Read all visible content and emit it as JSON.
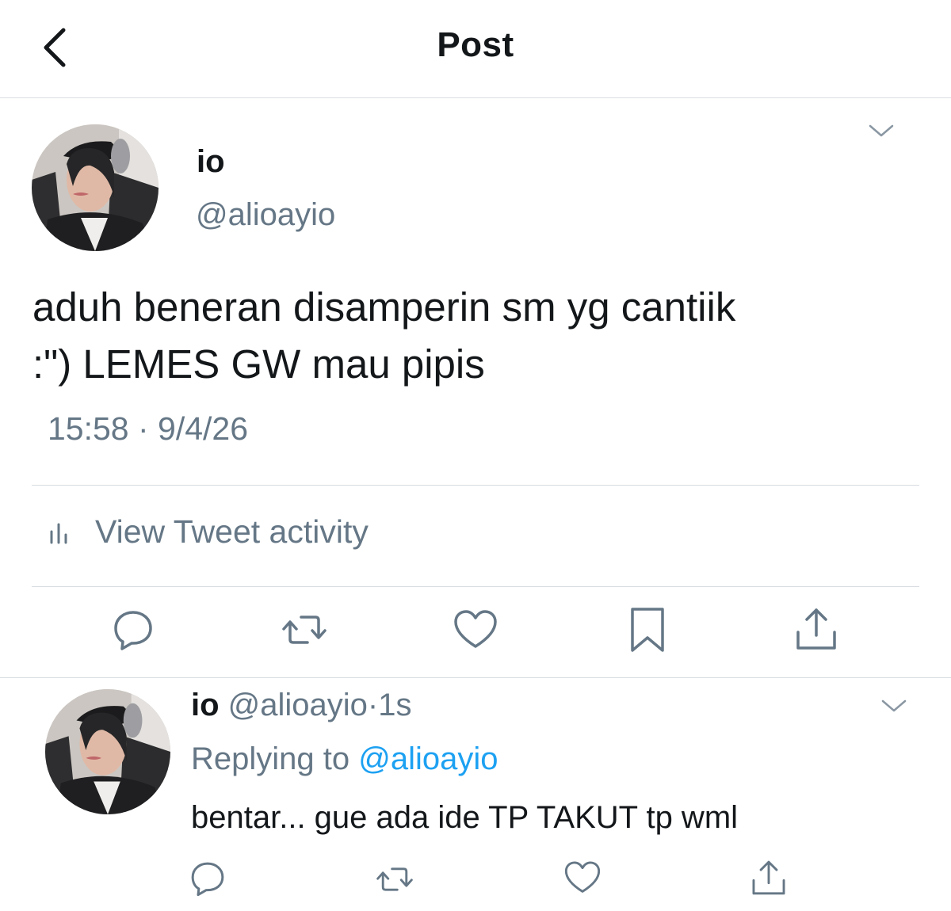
{
  "header": {
    "title": "Post",
    "back_icon": "chevron-left-icon"
  },
  "tweet": {
    "author_name": "io",
    "author_handle": "@alioayio",
    "text_line1": "aduh beneran disamperin sm yg cantiik",
    "text_line2": ":\") LEMES GW mau pipis",
    "timestamp": "15:58 · 9/4/26",
    "activity_label": "View Tweet activity",
    "actions": [
      "reply-icon",
      "retweet-icon",
      "like-icon",
      "bookmark-icon",
      "share-icon"
    ]
  },
  "reply": {
    "author_name": "io",
    "author_handle": "@alioayio",
    "time": "·1s",
    "replying_prefix": "Replying to",
    "replying_to": "@alioayio",
    "text": "bentar... gue ada ide TP TAKUT tp wml",
    "actions": [
      "reply-icon",
      "retweet-icon",
      "like-icon",
      "share-icon"
    ]
  },
  "colors": {
    "text_primary": "#14171a",
    "text_secondary": "#657786",
    "link": "#1da1f2",
    "divider": "#d9dde1"
  }
}
